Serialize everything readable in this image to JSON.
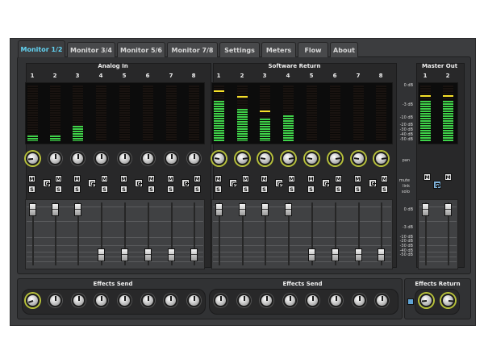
{
  "tabs": [
    {
      "label": "Monitor 1/2",
      "active": true
    },
    {
      "label": "Monitor 3/4",
      "active": false
    },
    {
      "label": "Monitor 5/6",
      "active": false
    },
    {
      "label": "Monitor 7/8",
      "active": false
    },
    {
      "label": "Settings",
      "active": false
    },
    {
      "label": "Meters",
      "active": false
    },
    {
      "label": "Flow",
      "active": false
    },
    {
      "label": "About",
      "active": false
    }
  ],
  "analog_in": {
    "title": "Analog In",
    "channels": [
      {
        "num": "1",
        "level": 0.1,
        "peak": null,
        "fader": 0.98,
        "pan": 0.15,
        "pan_lit": true
      },
      {
        "num": "2",
        "level": 0.1,
        "peak": null,
        "fader": 0.98,
        "pan": 0.5,
        "pan_lit": false
      },
      {
        "num": "3",
        "level": 0.28,
        "peak": null,
        "fader": 0.98,
        "pan": 0.5,
        "pan_lit": false
      },
      {
        "num": "4",
        "level": 0.0,
        "peak": null,
        "fader": 0.08,
        "pan": 0.5,
        "pan_lit": false
      },
      {
        "num": "5",
        "level": 0.0,
        "peak": null,
        "fader": 0.08,
        "pan": 0.5,
        "pan_lit": false
      },
      {
        "num": "6",
        "level": 0.0,
        "peak": null,
        "fader": 0.08,
        "pan": 0.5,
        "pan_lit": false
      },
      {
        "num": "7",
        "level": 0.0,
        "peak": null,
        "fader": 0.08,
        "pan": 0.5,
        "pan_lit": false
      },
      {
        "num": "8",
        "level": 0.0,
        "peak": null,
        "fader": 0.08,
        "pan": 0.5,
        "pan_lit": false
      }
    ]
  },
  "software_return": {
    "title": "Software Return",
    "channels": [
      {
        "num": "1",
        "level": 0.72,
        "peak": 0.88,
        "fader": 0.98,
        "pan": 0.2,
        "pan_lit": true
      },
      {
        "num": "2",
        "level": 0.58,
        "peak": 0.78,
        "fader": 0.98,
        "pan": 0.8,
        "pan_lit": true
      },
      {
        "num": "3",
        "level": 0.4,
        "peak": 0.52,
        "fader": 0.98,
        "pan": 0.2,
        "pan_lit": true
      },
      {
        "num": "4",
        "level": 0.46,
        "peak": null,
        "fader": 0.98,
        "pan": 0.8,
        "pan_lit": true
      },
      {
        "num": "5",
        "level": 0.0,
        "peak": null,
        "fader": 0.08,
        "pan": 0.2,
        "pan_lit": true
      },
      {
        "num": "6",
        "level": 0.0,
        "peak": null,
        "fader": 0.08,
        "pan": 0.8,
        "pan_lit": true
      },
      {
        "num": "7",
        "level": 0.0,
        "peak": null,
        "fader": 0.08,
        "pan": 0.2,
        "pan_lit": true
      },
      {
        "num": "8",
        "level": 0.0,
        "peak": null,
        "fader": 0.08,
        "pan": 0.8,
        "pan_lit": true
      }
    ]
  },
  "master_out": {
    "title": "Master Out",
    "channels": [
      {
        "num": "1",
        "level": 0.72,
        "peak": 0.8,
        "fader": 0.98
      },
      {
        "num": "2",
        "level": 0.72,
        "peak": 0.8,
        "fader": 0.98
      }
    ]
  },
  "meter_scale": [
    "0 dB",
    "-3 dB",
    "-10 dB",
    "-20 dB",
    "-30 dB",
    "-40 dB",
    "-50 dB"
  ],
  "fader_scale": [
    "0 dB",
    "-3 dB",
    "-10 dB",
    "-20 dB",
    "-30 dB",
    "-40 dB",
    "-50 dB"
  ],
  "row_labels": {
    "pan": "pan",
    "mute": "mute",
    "link": "link",
    "solo": "solo"
  },
  "ms": {
    "mute": "M",
    "solo": "S"
  },
  "effects_send": {
    "left_title": "Effects Send",
    "right_title": "Effects Send",
    "left_knobs": [
      0.1,
      0.5,
      0.5,
      0.5,
      0.5,
      0.5,
      0.5,
      0.5
    ],
    "right_knobs": [
      0.5,
      0.5,
      0.5,
      0.5,
      0.5,
      0.5,
      0.5,
      0.5
    ]
  },
  "effects_return": {
    "title": "Effects Return",
    "knobs": [
      0.15,
      0.85
    ]
  },
  "colors": {
    "active_tab": "#62d3f2",
    "meter_green": "#3fd24a",
    "peak_yellow": "#f7e12a",
    "knob_ring": "#b8c23b"
  }
}
